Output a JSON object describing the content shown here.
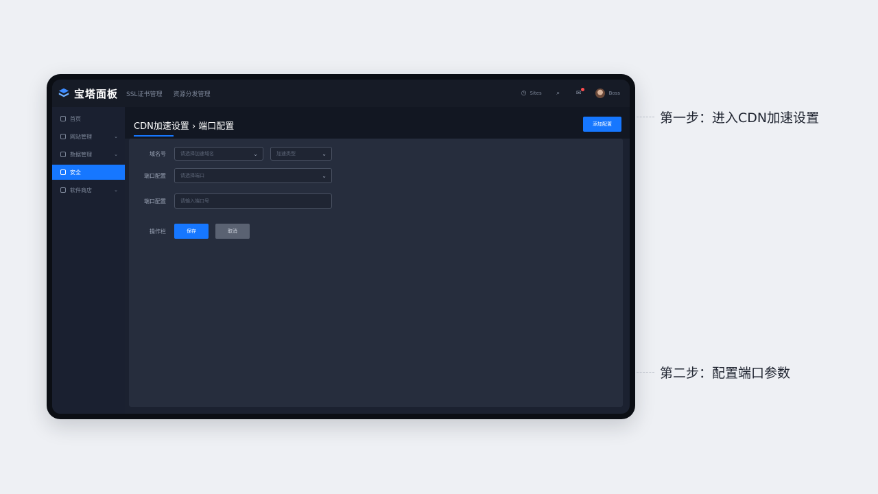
{
  "app": {
    "brand": "宝塔面板",
    "top_nav": [
      "SSL证书管理",
      "资源分发管理"
    ],
    "top_right": {
      "status_label": "Sites",
      "user_label": "Boss"
    }
  },
  "sidebar": {
    "items": [
      {
        "label": "首页",
        "icon": "home-icon",
        "active": false,
        "has_chevron": false
      },
      {
        "label": "网站管理",
        "icon": "site-icon",
        "active": false,
        "has_chevron": true
      },
      {
        "label": "数据管理",
        "icon": "data-icon",
        "active": false,
        "has_chevron": true
      },
      {
        "label": "安全",
        "icon": "security-icon",
        "active": true,
        "has_chevron": false
      },
      {
        "label": "软件商店",
        "icon": "store-icon",
        "active": false,
        "has_chevron": true
      }
    ]
  },
  "main": {
    "title": "CDN加速设置 › 端口配置",
    "header_button": "添加配置",
    "form": {
      "domain_label": "域名号",
      "domain_select_placeholder": "请选择加速域名",
      "type_select_placeholder": "加速类型",
      "port_label": "端口配置",
      "port_select_placeholder": "请选择端口",
      "port_input_label": "端口配置",
      "port_input_placeholder": "请输入端口号",
      "action_label": "操作栏",
      "save_button": "保存",
      "cancel_button": "取消"
    }
  },
  "annotations": {
    "step1": "第一步：进入CDN加速设置",
    "step2": "第二步：配置端口参数"
  },
  "colors": {
    "accent": "#1677ff",
    "background": "#eef0f4",
    "panel": "#262d3d"
  }
}
